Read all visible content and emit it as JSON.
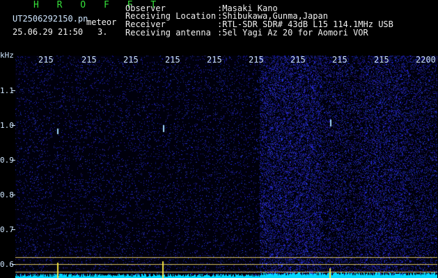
{
  "header": {
    "title": "H R O F F T",
    "filename": "UT2506292150.pn",
    "mode": "meteor",
    "datetime": "25.06.29 21:50",
    "count": "3.",
    "fields": [
      {
        "label": "Observer",
        "value": ":Masaki Kano"
      },
      {
        "label": "Receiving Location",
        "value": ":Shibukawa,Gunma,Japan"
      },
      {
        "label": "Receiver",
        "value": ":RTL-SDR SDR# 43dB L15 114.1MHz USB"
      },
      {
        "label": "Receiving antenna",
        "value": ":5el Yagi Az 20 for Aomori VOR"
      }
    ]
  },
  "axis": {
    "unit": "kHz",
    "y_ticks": [
      "1.1",
      "1.0",
      "0.9",
      "0.8",
      "0.7",
      "0.6"
    ],
    "x_ticks": [
      "215",
      "215",
      "215",
      "215",
      "215",
      "215",
      "215",
      "215",
      "215",
      "2200"
    ]
  },
  "colors": {
    "background": "#000000",
    "noise_blue": "#1a22c8",
    "signal_cyan": "#00e0ff",
    "header_green": "#36e03a",
    "line_yellow": "#e8d060"
  }
}
